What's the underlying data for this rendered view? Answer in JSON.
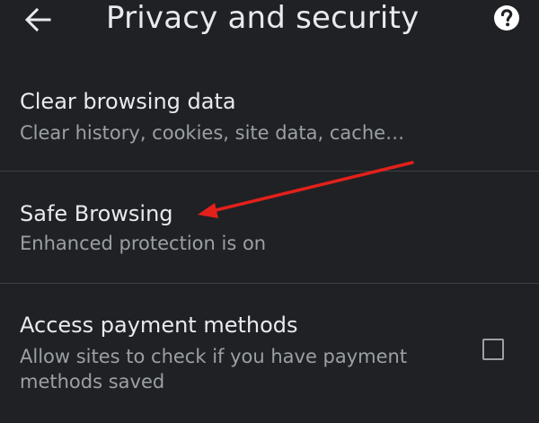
{
  "header": {
    "title": "Privacy and security",
    "back_icon": "arrow-left-icon",
    "help_icon": "help-circle-icon"
  },
  "settings": [
    {
      "title": "Clear browsing data",
      "subtitle": "Clear history, cookies, site data, cache…"
    },
    {
      "title": "Safe Browsing",
      "subtitle": "Enhanced protection is on"
    },
    {
      "title": "Access payment methods",
      "subtitle": "Allow sites to check if you have payment methods saved",
      "checked": false
    }
  ],
  "colors": {
    "background": "#202124",
    "text_primary": "#e8eaed",
    "text_secondary": "#9aa0a6",
    "divider": "#3c4043",
    "annotation_arrow": "#e3201b"
  }
}
